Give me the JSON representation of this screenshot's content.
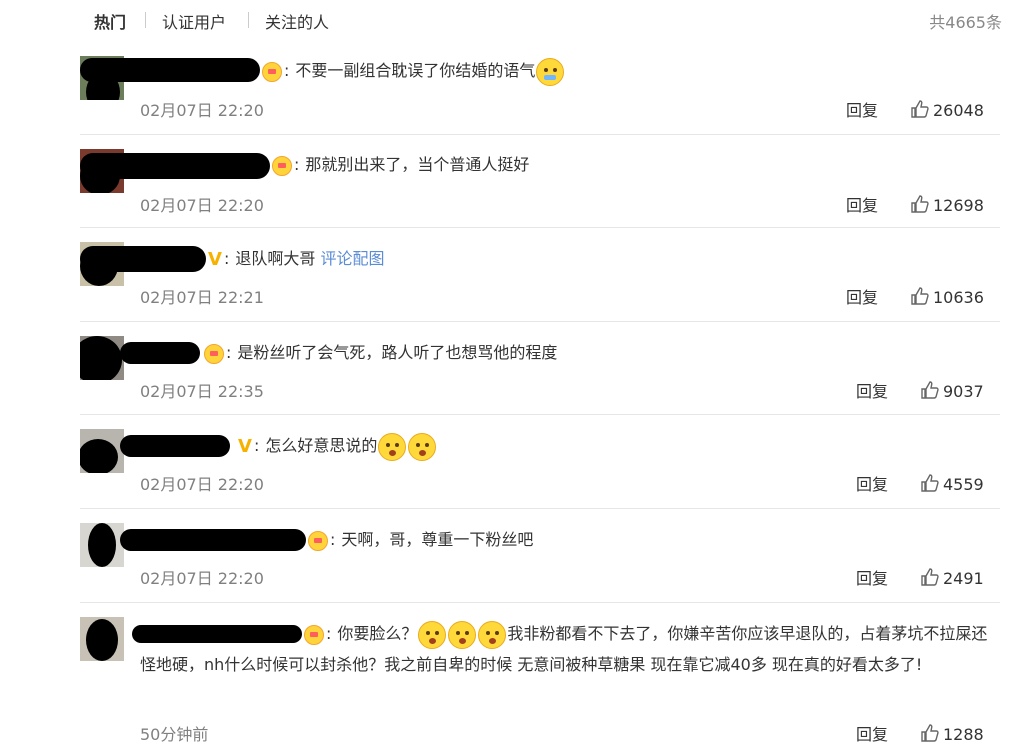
{
  "tabs": [
    {
      "label": "热门"
    },
    {
      "label": "认证用户"
    },
    {
      "label": "关注的人"
    }
  ],
  "total_count": "共4665条",
  "actions": {
    "reply_label": "回复"
  },
  "comments": [
    {
      "text": "不要一副组合耽误了你结婚的语气",
      "time": "02月07日 22:20",
      "likes": "26048",
      "badge": "crown",
      "emoji_after": "tears"
    },
    {
      "text": "那就别出来了，当个普通人挺好",
      "time": "02月07日 22:20",
      "likes": "12698",
      "badge": "crown"
    },
    {
      "text": "退队啊大哥",
      "link": "评论配图",
      "time": "02月07日 22:21",
      "likes": "10636",
      "badge": "v"
    },
    {
      "text": "是粉丝听了会气死，路人听了也想骂他的程度",
      "time": "02月07日 22:35",
      "likes": "9037",
      "badge": "crown"
    },
    {
      "text": "怎么好意思说的",
      "time": "02月07日 22:20",
      "likes": "4559",
      "badge": "v"
    },
    {
      "text": "天啊，哥，尊重一下粉丝吧",
      "time": "02月07日 22:20",
      "likes": "2491",
      "badge": "crown"
    },
    {
      "text_a": "你要脸么？",
      "text_b": "我非粉都看不下去了，你嫌辛苦你应该早退队的，占着茅坑不拉屎还怪地硬，nh什么时候可以封杀他？我之前自卑的时候 无意间被种草糖果 现在靠它减40多 现在真的好看太多了!",
      "time": "50分钟前",
      "likes": "1288",
      "badge": "crown"
    }
  ]
}
